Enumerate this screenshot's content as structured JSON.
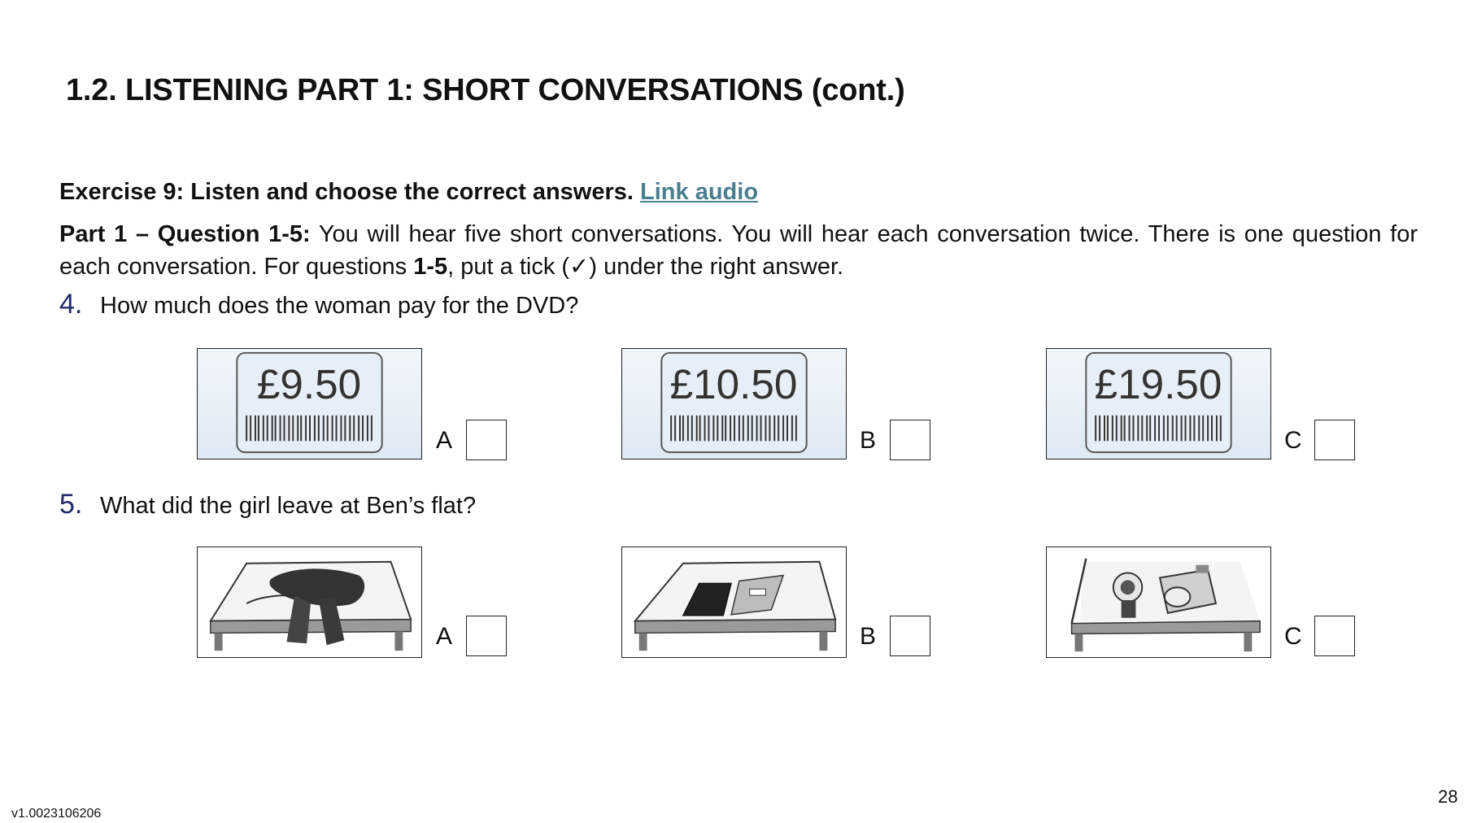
{
  "title": "1.2. LISTENING PART 1: SHORT CONVERSATIONS (cont.)",
  "exercise": {
    "label": "Exercise 9: Listen and choose the correct answers.",
    "link": "Link audio"
  },
  "instructions": {
    "part_label": "Part 1 – Question 1-5:",
    "text_a": " You will hear five short conversations. You will hear each conversation twice. There is one question for each conversation. For questions ",
    "bold_range": "1-5",
    "text_b": ", put a tick (✓) under the right answer."
  },
  "questions": [
    {
      "number": "4.",
      "text": "How much does the woman pay for the DVD?",
      "options": [
        {
          "letter": "A",
          "price": "£9.50"
        },
        {
          "letter": "B",
          "price": "£10.50"
        },
        {
          "letter": "C",
          "price": "£19.50"
        }
      ]
    },
    {
      "number": "5.",
      "text": "What did the girl leave at Ben’s flat?",
      "options": [
        {
          "letter": "A",
          "picture": "scarf-on-table"
        },
        {
          "letter": "B",
          "picture": "books-on-table"
        },
        {
          "letter": "C",
          "picture": "torch-and-camera-on-table"
        }
      ]
    }
  ],
  "footer": {
    "version": "v1.0023106206",
    "page": "28"
  }
}
